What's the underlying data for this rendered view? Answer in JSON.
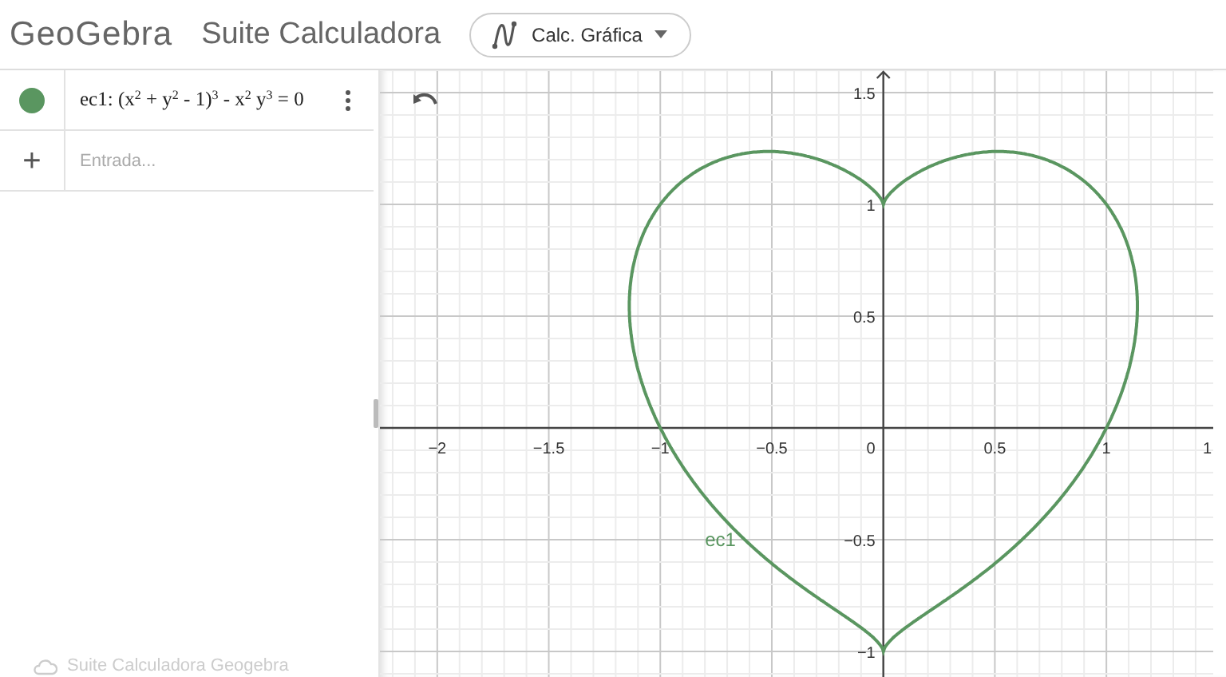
{
  "header": {
    "logo": "GeoGebra",
    "title": "Suite Calculadora",
    "app_menu": {
      "label": "Calc. Gráfica"
    }
  },
  "algebra": {
    "items": [
      {
        "kind": "equation",
        "text": "ec1: (x$^{2}$ + y$^{2}$ - 1)$^{3}$ - x$^{2}$ y$^{3}$ = 0",
        "visible": true,
        "color": "#5a9660"
      },
      {
        "kind": "input",
        "symbol": "+",
        "placeholder": "Entrada..."
      }
    ],
    "footer": "Suite Calculadora Geogebra"
  },
  "graph": {
    "x_tick_labels": [
      "−2",
      "−1.5",
      "−1",
      "−0.5",
      "0",
      "0.5",
      "1",
      "1"
    ],
    "y_tick_labels": [
      "1.5",
      "1",
      "0.5",
      "−0.5",
      "−1"
    ],
    "curve": {
      "label": "ec1",
      "color": "#5a9660"
    }
  }
}
